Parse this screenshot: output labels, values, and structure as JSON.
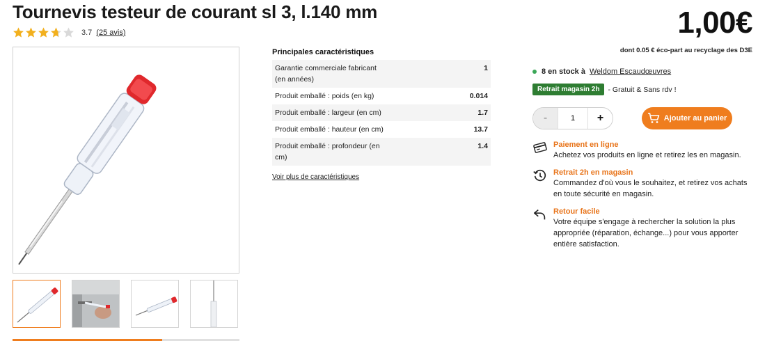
{
  "product": {
    "title": "Tournevis testeur de courant sl 3, l.140 mm",
    "rating": 3.7,
    "rating_text": "3.7",
    "reviews_text": "(25 avis)"
  },
  "gallery": {
    "thumbnail_count": 4,
    "scroll_progress": 0.66
  },
  "specs": {
    "title": "Principales caractéristiques",
    "rows": [
      {
        "label": "Garantie commerciale fabricant (en années)",
        "value": "1"
      },
      {
        "label": "Produit emballé : poids (en kg)",
        "value": "0.014"
      },
      {
        "label": "Produit emballé : largeur (en cm)",
        "value": "1.7"
      },
      {
        "label": "Produit emballé : hauteur (en cm)",
        "value": "13.7"
      },
      {
        "label": "Produit emballé : profondeur (en cm)",
        "value": "1.4"
      }
    ],
    "more_link": "Voir plus de caractéristiques"
  },
  "purchase": {
    "price": "1,00€",
    "eco_part": "dont 0.05 € éco-part au recyclage des D3E",
    "stock_text": "8 en stock à",
    "store_name": "Weldom Escaudœuvres",
    "pickup_badge": "Retrait magasin 2h",
    "pickup_text": "- Gratuit & Sans rdv !",
    "qty_minus": "-",
    "qty_value": "1",
    "qty_plus": "+",
    "add_to_cart": "Ajouter au panier"
  },
  "features": [
    {
      "icon": "card-icon",
      "title": "Paiement en ligne",
      "desc": "Achetez vos produits en ligne et retirez les en magasin."
    },
    {
      "icon": "clock-arrow-icon",
      "title": "Retrait 2h en magasin",
      "desc": "Commandez d'où vous le souhaitez, et retirez vos achats en toute sécurité en magasin."
    },
    {
      "icon": "return-arrow-icon",
      "title": "Retour facile",
      "desc": "Votre équipe s'engage à rechercher la solution la plus appropriée (réparation, échange...) pour vous apporter entière satisfaction."
    }
  ],
  "colors": {
    "accent": "#ef7d1e",
    "accent_text": "#e8741a",
    "success": "#2e7d32",
    "stock_dot": "#3aa757",
    "star": "#f2b01e"
  }
}
